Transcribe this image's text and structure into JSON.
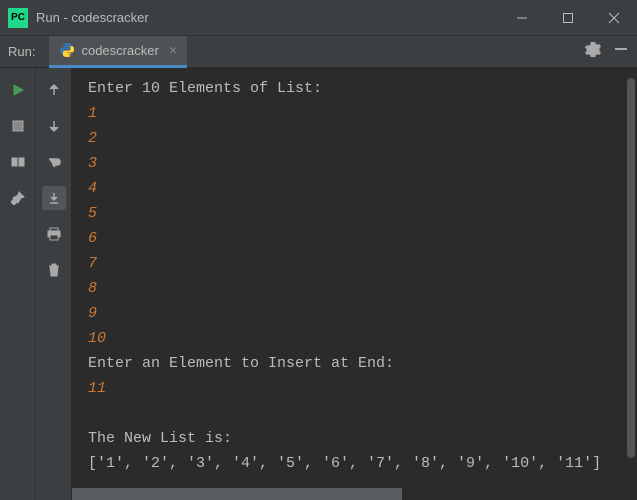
{
  "window": {
    "title": "Run - codescracker",
    "app_icon_text": "PC"
  },
  "toolbar": {
    "run_label": "Run:",
    "tab_name": "codescracker"
  },
  "console": {
    "lines": [
      {
        "type": "prompt",
        "text": "Enter 10 Elements of List:"
      },
      {
        "type": "input",
        "text": "1"
      },
      {
        "type": "input",
        "text": "2"
      },
      {
        "type": "input",
        "text": "3"
      },
      {
        "type": "input",
        "text": "4"
      },
      {
        "type": "input",
        "text": "5"
      },
      {
        "type": "input",
        "text": "6"
      },
      {
        "type": "input",
        "text": "7"
      },
      {
        "type": "input",
        "text": "8"
      },
      {
        "type": "input",
        "text": "9"
      },
      {
        "type": "input",
        "text": "10"
      },
      {
        "type": "prompt",
        "text": "Enter an Element to Insert at End:"
      },
      {
        "type": "input",
        "text": "11"
      },
      {
        "type": "blank",
        "text": ""
      },
      {
        "type": "prompt",
        "text": "The New List is:"
      },
      {
        "type": "output",
        "text": "['1', '2', '3', '4', '5', '6', '7', '8', '9', '10', '11']"
      }
    ]
  }
}
